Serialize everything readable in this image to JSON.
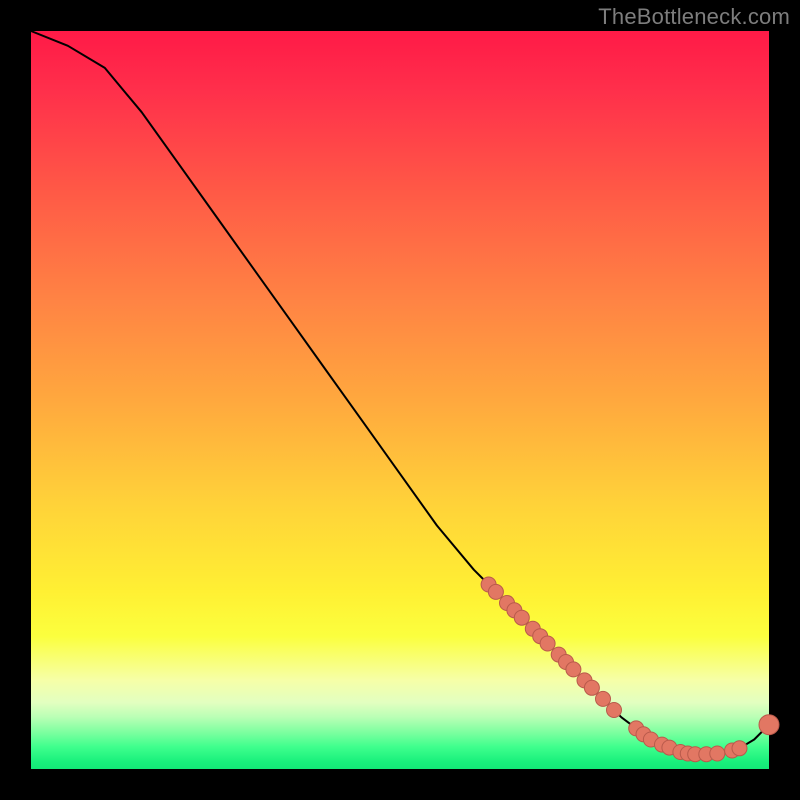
{
  "watermark": "TheBottleneck.com",
  "colors": {
    "background": "#000000",
    "dot_fill": "#e27763",
    "dot_stroke": "#b95a4b",
    "curve_stroke": "#000000"
  },
  "chart_data": {
    "type": "line",
    "title": "",
    "xlabel": "",
    "ylabel": "",
    "xlim": [
      0,
      100
    ],
    "ylim": [
      0,
      100
    ],
    "grid": false,
    "series": [
      {
        "name": "bottleneck-curve",
        "x": [
          0,
          5,
          10,
          15,
          20,
          25,
          30,
          35,
          40,
          45,
          50,
          55,
          60,
          62,
          64,
          66,
          68,
          70,
          72,
          74,
          76,
          78,
          80,
          82,
          84,
          86,
          88,
          90,
          92,
          94,
          96,
          98,
          100
        ],
        "y": [
          100,
          98,
          95,
          89,
          82,
          75,
          68,
          61,
          54,
          47,
          40,
          33,
          27,
          25,
          23,
          21,
          19,
          17,
          15,
          13,
          11,
          9,
          7,
          5.5,
          4,
          3,
          2.3,
          2,
          2,
          2.2,
          2.8,
          4,
          6
        ]
      }
    ],
    "markers": [
      {
        "x": 62,
        "y": 25
      },
      {
        "x": 63,
        "y": 24
      },
      {
        "x": 64.5,
        "y": 22.5
      },
      {
        "x": 65.5,
        "y": 21.5
      },
      {
        "x": 66.5,
        "y": 20.5
      },
      {
        "x": 68,
        "y": 19
      },
      {
        "x": 69,
        "y": 18
      },
      {
        "x": 70,
        "y": 17
      },
      {
        "x": 71.5,
        "y": 15.5
      },
      {
        "x": 72.5,
        "y": 14.5
      },
      {
        "x": 73.5,
        "y": 13.5
      },
      {
        "x": 75,
        "y": 12
      },
      {
        "x": 76,
        "y": 11
      },
      {
        "x": 77.5,
        "y": 9.5
      },
      {
        "x": 79,
        "y": 8
      },
      {
        "x": 82,
        "y": 5.5
      },
      {
        "x": 83,
        "y": 4.7
      },
      {
        "x": 84,
        "y": 4
      },
      {
        "x": 85.5,
        "y": 3.3
      },
      {
        "x": 86.5,
        "y": 2.9
      },
      {
        "x": 88,
        "y": 2.3
      },
      {
        "x": 89,
        "y": 2.1
      },
      {
        "x": 90,
        "y": 2
      },
      {
        "x": 91.5,
        "y": 2
      },
      {
        "x": 93,
        "y": 2.1
      },
      {
        "x": 95,
        "y": 2.5
      },
      {
        "x": 96,
        "y": 2.8
      },
      {
        "x": 100,
        "y": 6
      }
    ]
  }
}
